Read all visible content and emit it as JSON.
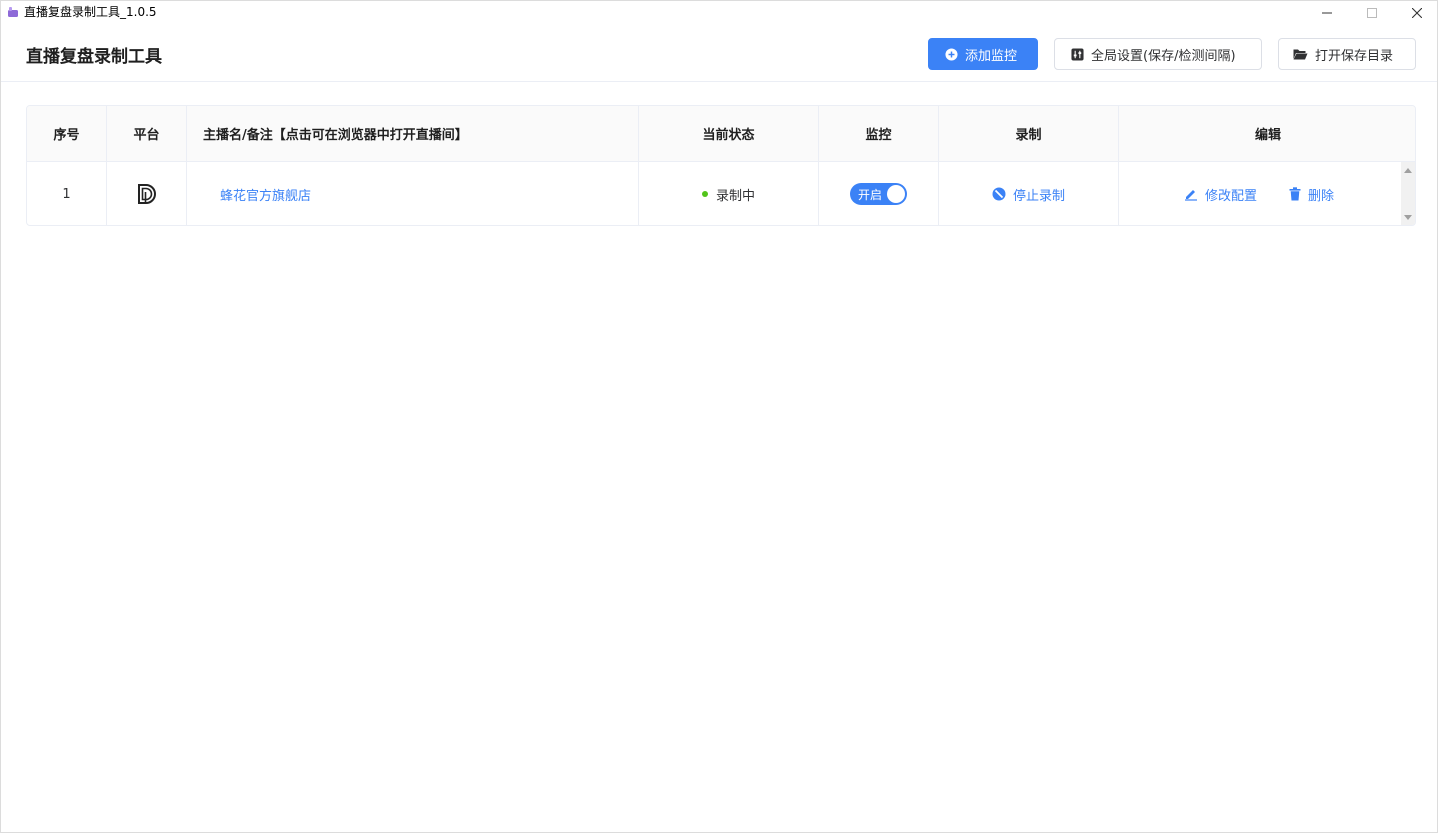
{
  "window": {
    "title": "直播复盘录制工具_1.0.5"
  },
  "header": {
    "title": "直播复盘录制工具",
    "add_label": "添加监控",
    "settings_label": "全局设置(保存/检测间隔)",
    "open_folder_label": "打开保存目录"
  },
  "table": {
    "columns": [
      "序号",
      "平台",
      "主播名/备注【点击可在浏览器中打开直播间】",
      "当前状态",
      "监控",
      "录制",
      "编辑"
    ],
    "rows": [
      {
        "index": "1",
        "platform_icon": "douyin-style-D-icon",
        "name": "蜂花官方旗舰店",
        "status": "录制中",
        "monitor": "开启",
        "record_action": "停止录制",
        "edit_label": "修改配置",
        "delete_label": "删除"
      }
    ]
  },
  "colors": {
    "accent": "#3b82f6",
    "status_ok": "#52c41a"
  }
}
